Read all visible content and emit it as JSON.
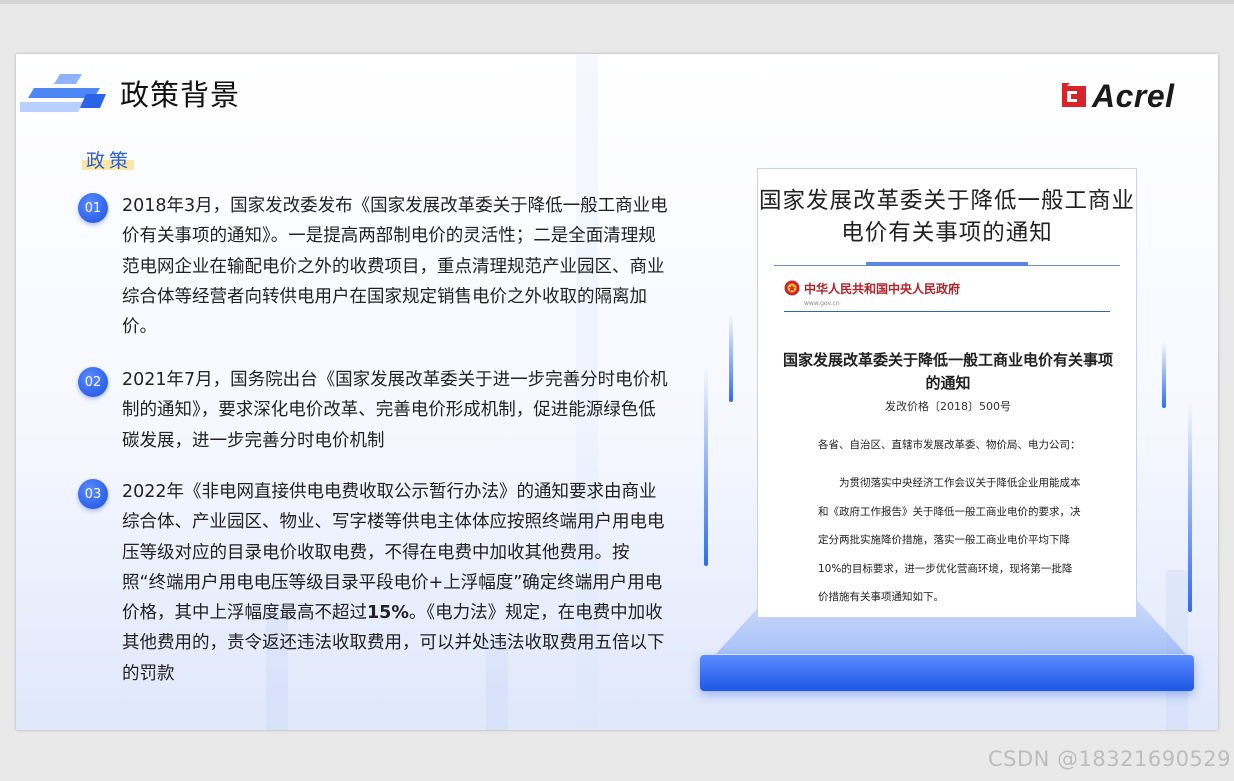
{
  "header": {
    "title": "政策背景",
    "logo_text": "Acrel"
  },
  "section_tag": "政策",
  "items": [
    {
      "num": "01",
      "text_pre": "2018年3月，国家发改委发布《国家发展改革委关于降低一般工商业电价有关事项的通知》。一是提高两部制电价的灵活性；二是全面清理规范电网企业在输配电价之外的收费项目，重点清理规范产业园区、商业综合体等经营者向转供电用户在国家规定销售电价之外收取的隔离加价。"
    },
    {
      "num": "02",
      "text_pre": "2021年7月，国务院出台《国家发展改革委关于进一步完善分时电价机制的通知》，要求深化电价改革、完善电价形成机制，促进能源绿色低碳发展，进一步完善分时电价机制"
    },
    {
      "num": "03",
      "text_pre": "2022年《非电网直接供电电费收取公示暂行办法》的通知要求由商业综合体、产业园区、物业、写字楼等供电主体体应按照终端用户用电电压等级对应的目录电价收取电费，不得在电费中加收其他费用。按照“终端用户用电电压等级目录平段电价+上浮幅度”确定终端用户用电价格，其中上浮幅度最高不超过",
      "text_bold": "15%",
      "text_post": "。《电力法》规定，在电费中加收其他费用的，责令返还违法收取费用，可以并处违法收取费用五倍以下的罚款"
    }
  ],
  "card": {
    "title": "国家发展改革委关于降低一般工商业电价有关事项的通知",
    "doc_header": "中华人民共和国中央人民政府",
    "doc_url": "www.gov.cn",
    "doc_title": "国家发展改革委关于降低一般工商业电价有关事项的通知",
    "doc_number": "发改价格〔2018〕500号",
    "doc_addressee": "各省、自治区、直辖市发展改革委、物价局、电力公司：",
    "doc_body": "为贯彻落实中央经济工作会议关于降低企业用能成本和《政府工作报告》关于降低一般工商业电价的要求，决定分两批实施降价措施，落实一般工商业电价平均下降10%的目标要求，进一步优化营商环境，现将第一批降价措施有关事项通知如下。"
  },
  "watermark": "CSDN @18321690529",
  "colors": {
    "accent": "#1e56e6",
    "tag_highlight": "#fde6a6",
    "logo_red": "#d8232a",
    "doc_red": "#b4222a"
  }
}
